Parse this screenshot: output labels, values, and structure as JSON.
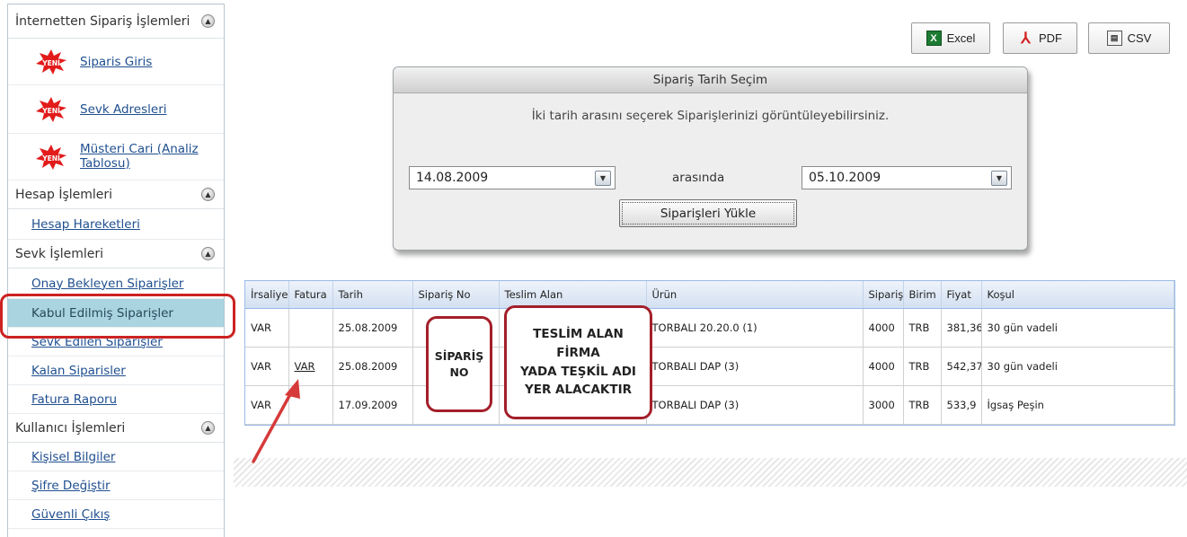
{
  "sidebar": {
    "sections": [
      {
        "title": "İnternetten Sipariş İşlemleri",
        "items": [
          {
            "label": "Siparis Giris",
            "badge": "YENİ"
          },
          {
            "label": "Sevk Adresleri",
            "badge": "YENİ"
          },
          {
            "label": "Müsteri Cari (Analiz Tablosu)",
            "badge": "YENİ"
          }
        ]
      },
      {
        "title": "Hesap İşlemleri",
        "items": [
          {
            "label": "Hesap Hareketleri"
          }
        ]
      },
      {
        "title": "Sevk İşlemleri",
        "items": [
          {
            "label": "Onay Bekleyen Siparişler"
          },
          {
            "label": "Kabul Edilmiş Siparişler"
          },
          {
            "label": "Sevk Edilen Siparişler"
          },
          {
            "label": "Kalan Siparisler"
          },
          {
            "label": "Fatura Raporu"
          }
        ]
      },
      {
        "title": "Kullanıcı İşlemleri",
        "items": [
          {
            "label": "Kişisel Bilgiler"
          },
          {
            "label": "Şifre Değiştir"
          },
          {
            "label": "Güvenli Çıkış"
          }
        ]
      }
    ],
    "selected_item": "Kabul Edilmiş Siparişler",
    "selected_color": "#a9d4e0",
    "highlight_color": "#cc2222"
  },
  "export": {
    "excel_label": "Excel",
    "pdf_label": "PDF",
    "csv_label": "CSV",
    "icons": [
      "excel-icon",
      "pdf-icon",
      "csv-icon"
    ]
  },
  "date_dialog": {
    "title": "Sipariş Tarih Seçim",
    "hint": "İki tarih arasını seçerek Siparişlerinizi görüntüleyebilirsiniz.",
    "start_date": "14.08.2009",
    "between_label": "arasında",
    "end_date": "05.10.2009",
    "load_button": "Siparişleri Yükle"
  },
  "grid": {
    "columns": [
      "İrsaliye",
      "Fatura",
      "Tarih",
      "Sipariş No",
      "Teslim Alan",
      "Ürün",
      "Sipariş",
      "Birim",
      "Fiyat",
      "Koşul"
    ],
    "rows": [
      {
        "irsaliye": "VAR",
        "fatura": "",
        "tarih": "25.08.2009",
        "siparis_no": "",
        "teslim_alan": "",
        "urun": "TORBALI 20.20.0 (1)",
        "siparis": "4000",
        "birim": "TRB",
        "fiyat": "381,36",
        "kosul": "30 gün vadeli"
      },
      {
        "irsaliye": "VAR",
        "fatura": "VAR",
        "tarih": "25.08.2009",
        "siparis_no": "",
        "teslim_alan": "",
        "urun": "TORBALI DAP (3)",
        "siparis": "4000",
        "birim": "TRB",
        "fiyat": "542,37",
        "kosul": "30 gün vadeli"
      },
      {
        "irsaliye": "VAR",
        "fatura": "",
        "tarih": "17.09.2009",
        "siparis_no": "",
        "teslim_alan": "",
        "urun": "TORBALI DAP (3)",
        "siparis": "3000",
        "birim": "TRB",
        "fiyat": "533,9",
        "kosul": "İgsaş Peşin"
      }
    ],
    "header_color": "#d3e0f1"
  },
  "callouts": {
    "siparis_no_line1": "SİPARİŞ",
    "siparis_no_line2": "NO",
    "teslim_line1": "TESLİM ALAN",
    "teslim_line2": "FİRMA",
    "teslim_line3": "YADA TEŞKİL ADI",
    "teslim_line4": "YER ALACAKTIR",
    "border_color": "#a31f2a"
  }
}
